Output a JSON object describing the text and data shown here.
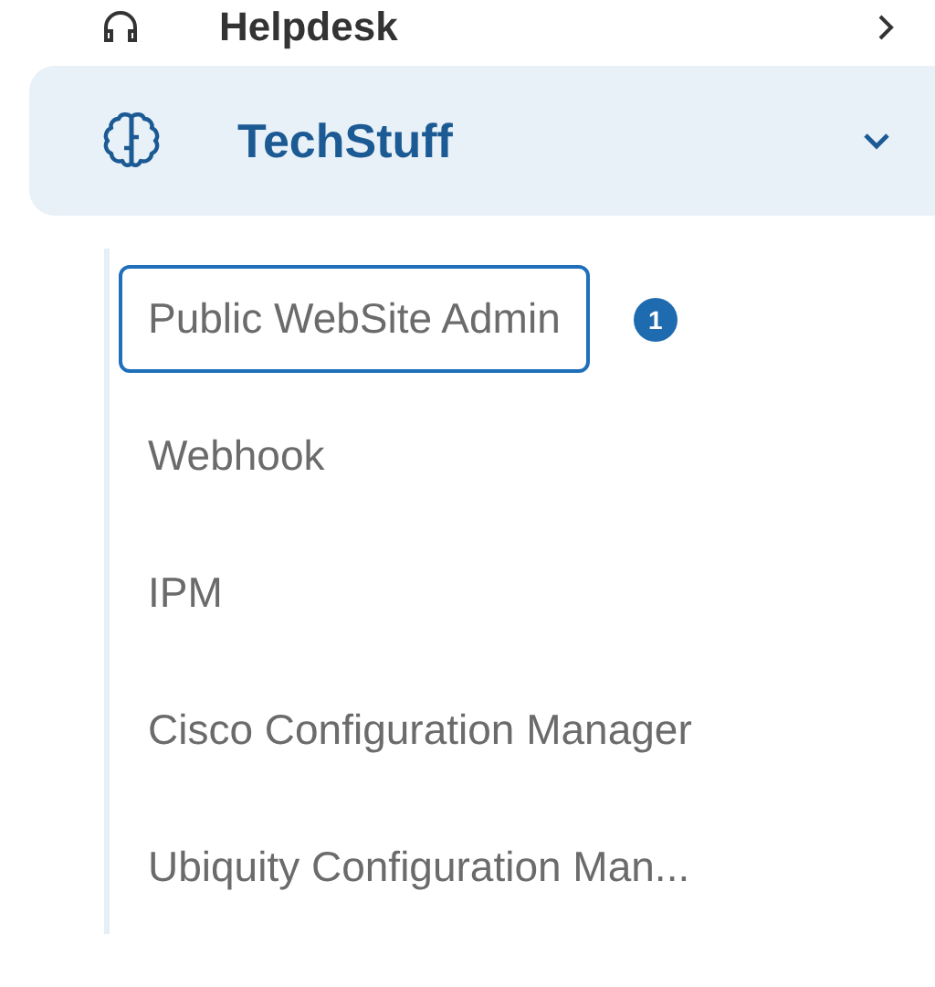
{
  "previous_item": {
    "label": "Helpdesk"
  },
  "group": {
    "label": "TechStuff",
    "expanded": true,
    "items": [
      {
        "label": "Public WebSite Admin",
        "selected": true,
        "badge": "1"
      },
      {
        "label": "Webhook",
        "selected": false
      },
      {
        "label": "IPM",
        "selected": false
      },
      {
        "label": "Cisco Configuration Manager",
        "selected": false
      },
      {
        "label": "Ubiquity Configuration Man...",
        "selected": false
      }
    ]
  }
}
